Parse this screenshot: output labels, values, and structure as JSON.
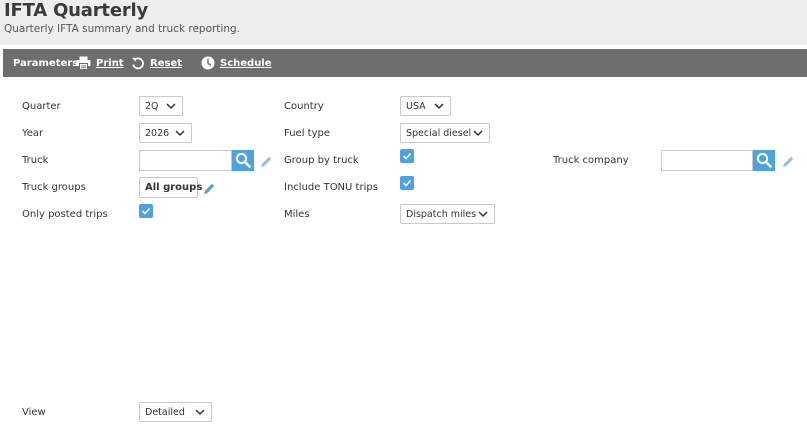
{
  "header": {
    "title": "IFTA Quarterly",
    "subtitle": "Quarterly IFTA summary and truck reporting."
  },
  "toolbar": {
    "title": "Parameters",
    "print_label": "Print",
    "reset_label": "Reset",
    "schedule_label": "Schedule"
  },
  "form": {
    "quarter": {
      "label": "Quarter",
      "value": "2Q"
    },
    "year": {
      "label": "Year",
      "value": "2026"
    },
    "truck": {
      "label": "Truck",
      "value": ""
    },
    "truck_groups": {
      "label": "Truck groups",
      "button": "All groups"
    },
    "only_posted_trips": {
      "label": "Only posted trips",
      "checked": true
    },
    "country": {
      "label": "Country",
      "value": "USA"
    },
    "fuel_type": {
      "label": "Fuel type",
      "value": "Special diesel"
    },
    "group_by_truck": {
      "label": "Group by truck",
      "checked": true
    },
    "include_tonu_trips": {
      "label": "Include TONU trips",
      "checked": true
    },
    "miles": {
      "label": "Miles",
      "value": "Dispatch miles"
    },
    "truck_company": {
      "label": "Truck company",
      "value": ""
    },
    "view": {
      "label": "View",
      "value": "Detailed"
    }
  },
  "colors": {
    "accent": "#4da3e0",
    "toolbar_bg": "#6e6e6e",
    "header_bg": "#eeeeee"
  }
}
